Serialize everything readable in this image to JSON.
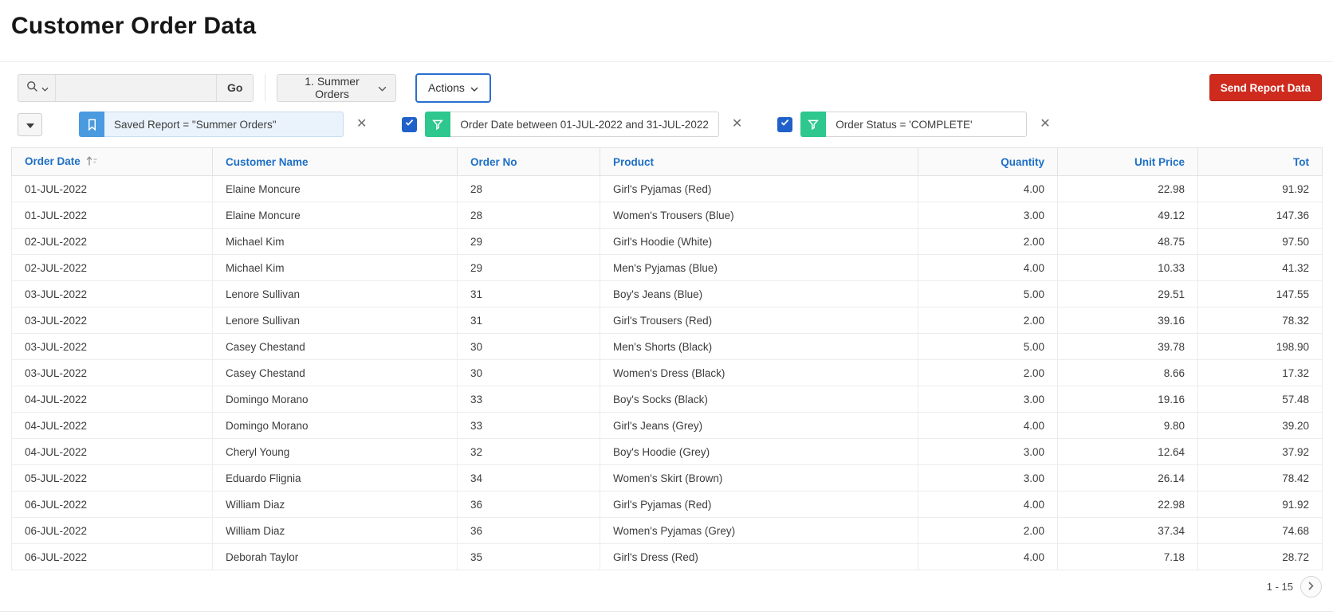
{
  "page": {
    "title": "Customer Order Data"
  },
  "toolbar": {
    "search_placeholder": "",
    "search_value": "",
    "go_label": "Go",
    "report_select_value": "1. Summer Orders",
    "actions_label": "Actions",
    "send_report_label": "Send Report Data"
  },
  "filter_bar": {
    "saved_report": {
      "label": "Saved Report = \"Summer Orders\""
    },
    "filters": [
      {
        "label": "Order Date between 01-JUL-2022 and 31-JUL-2022",
        "checked": true
      },
      {
        "label": "Order Status = 'COMPLETE'",
        "checked": true
      }
    ]
  },
  "table": {
    "columns": [
      {
        "label": "Order Date",
        "align": "left",
        "sorted": "asc"
      },
      {
        "label": "Customer Name",
        "align": "left"
      },
      {
        "label": "Order No",
        "align": "left"
      },
      {
        "label": "Product",
        "align": "left"
      },
      {
        "label": "Quantity",
        "align": "right"
      },
      {
        "label": "Unit Price",
        "align": "right"
      },
      {
        "label": "Tot",
        "align": "right"
      }
    ],
    "rows": [
      [
        "01-JUL-2022",
        "Elaine Moncure",
        "28",
        "Girl's Pyjamas (Red)",
        "4.00",
        "22.98",
        "91.92"
      ],
      [
        "01-JUL-2022",
        "Elaine Moncure",
        "28",
        "Women's Trousers (Blue)",
        "3.00",
        "49.12",
        "147.36"
      ],
      [
        "02-JUL-2022",
        "Michael Kim",
        "29",
        "Girl's Hoodie (White)",
        "2.00",
        "48.75",
        "97.50"
      ],
      [
        "02-JUL-2022",
        "Michael Kim",
        "29",
        "Men's Pyjamas (Blue)",
        "4.00",
        "10.33",
        "41.32"
      ],
      [
        "03-JUL-2022",
        "Lenore Sullivan",
        "31",
        "Boy's Jeans (Blue)",
        "5.00",
        "29.51",
        "147.55"
      ],
      [
        "03-JUL-2022",
        "Lenore Sullivan",
        "31",
        "Girl's Trousers (Red)",
        "2.00",
        "39.16",
        "78.32"
      ],
      [
        "03-JUL-2022",
        "Casey Chestand",
        "30",
        "Men's Shorts (Black)",
        "5.00",
        "39.78",
        "198.90"
      ],
      [
        "03-JUL-2022",
        "Casey Chestand",
        "30",
        "Women's Dress (Black)",
        "2.00",
        "8.66",
        "17.32"
      ],
      [
        "04-JUL-2022",
        "Domingo Morano",
        "33",
        "Boy's Socks (Black)",
        "3.00",
        "19.16",
        "57.48"
      ],
      [
        "04-JUL-2022",
        "Domingo Morano",
        "33",
        "Girl's Jeans (Grey)",
        "4.00",
        "9.80",
        "39.20"
      ],
      [
        "04-JUL-2022",
        "Cheryl Young",
        "32",
        "Boy's Hoodie (Grey)",
        "3.00",
        "12.64",
        "37.92"
      ],
      [
        "05-JUL-2022",
        "Eduardo Flignia",
        "34",
        "Women's Skirt (Brown)",
        "3.00",
        "26.14",
        "78.42"
      ],
      [
        "06-JUL-2022",
        "William Diaz",
        "36",
        "Girl's Pyjamas (Red)",
        "4.00",
        "22.98",
        "91.92"
      ],
      [
        "06-JUL-2022",
        "William Diaz",
        "36",
        "Women's Pyjamas (Grey)",
        "2.00",
        "37.34",
        "74.68"
      ],
      [
        "06-JUL-2022",
        "Deborah Taylor",
        "35",
        "Girl's Dress (Red)",
        "4.00",
        "7.18",
        "28.72"
      ]
    ]
  },
  "pagination": {
    "range_label": "1 - 15"
  },
  "colors": {
    "header_link_blue": "#1d6fc6",
    "checkbox_blue": "#2061c9",
    "bookmark_blue": "#4a9ae0",
    "funnel_green": "#2ec78d",
    "send_button_red": "#ce2b1e",
    "saved_chip_bg": "#eaf3fc"
  }
}
